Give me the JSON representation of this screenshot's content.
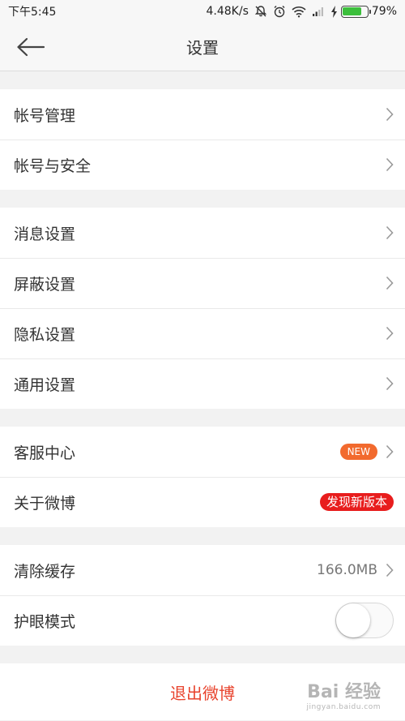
{
  "status_bar": {
    "time": "下午5:45",
    "speed": "4.48K/s",
    "battery": "79%",
    "battery_level": 0.79,
    "icons": [
      "mute-bell-icon",
      "alarm-icon",
      "wifi-icon",
      "signal-icon",
      "charging-icon",
      "battery-icon"
    ]
  },
  "header": {
    "title": "设置",
    "back_icon": "back-arrow-icon"
  },
  "groups": [
    {
      "items": [
        {
          "label": "帐号管理"
        },
        {
          "label": "帐号与安全"
        }
      ]
    },
    {
      "items": [
        {
          "label": "消息设置"
        },
        {
          "label": "屏蔽设置"
        },
        {
          "label": "隐私设置"
        },
        {
          "label": "通用设置"
        }
      ]
    },
    {
      "items": [
        {
          "label": "客服中心",
          "badge": "NEW"
        },
        {
          "label": "关于微博",
          "badge": "发现新版本"
        }
      ]
    },
    {
      "items": [
        {
          "label": "清除缓存",
          "value": "166.0MB"
        },
        {
          "label": "护眼模式",
          "toggle": false
        }
      ]
    }
  ],
  "logout_label": "退出微博",
  "watermark": {
    "text": "Bai 经验",
    "sub": "jingyan.baidu.com"
  },
  "colors": {
    "accent": "#e8432d",
    "badge_new": "#f26a2e",
    "badge_version": "#e81d1d",
    "battery_green": "#3cbf3c"
  }
}
